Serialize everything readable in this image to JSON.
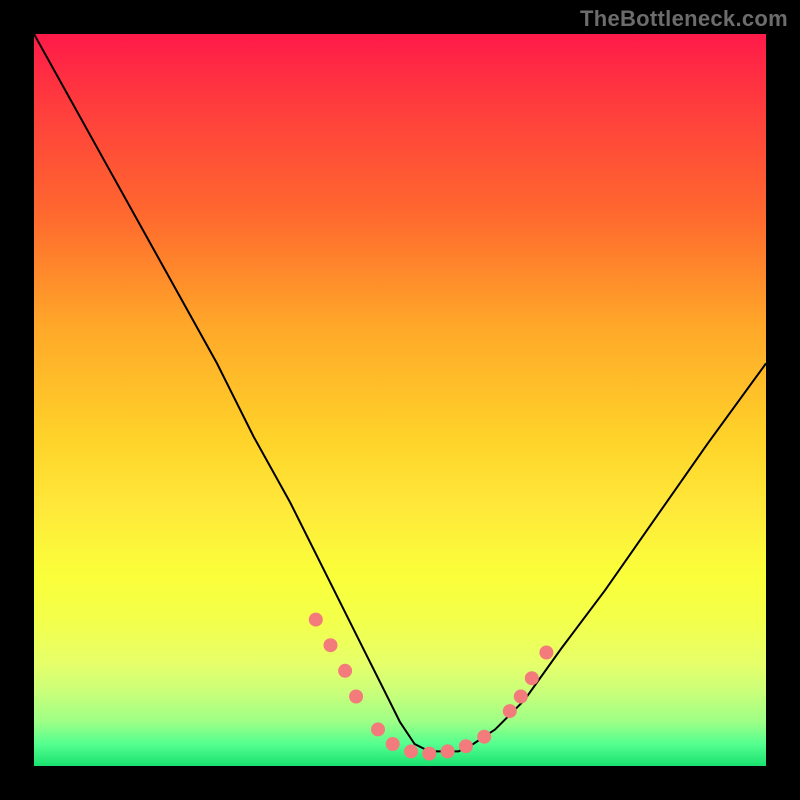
{
  "watermark": "TheBottleneck.com",
  "chart_data": {
    "type": "line",
    "title": "",
    "xlabel": "",
    "ylabel": "",
    "xlim": [
      0,
      100
    ],
    "ylim": [
      0,
      100
    ],
    "grid": false,
    "series": [
      {
        "name": "bottleneck-curve",
        "note": "V-shaped curve; y is qualitative (red=bad, green=good). Values are percent of plot height from top.",
        "x": [
          0,
          5,
          10,
          15,
          20,
          25,
          30,
          35,
          40,
          45,
          48,
          50,
          52,
          54,
          56,
          58,
          60,
          63,
          67,
          72,
          78,
          85,
          92,
          100
        ],
        "y": [
          0,
          9,
          18,
          27,
          36,
          45,
          55,
          64,
          74,
          84,
          90,
          94,
          97,
          98,
          98,
          98,
          97,
          95,
          91,
          84,
          76,
          66,
          56,
          45
        ]
      }
    ],
    "markers": {
      "name": "highlight-dots",
      "color": "#f47b7b",
      "x": [
        38.5,
        40.5,
        42.5,
        44.0,
        47.0,
        49.0,
        51.5,
        54.0,
        56.5,
        59.0,
        61.5,
        65.0,
        66.5,
        68.0,
        70.0
      ],
      "y": [
        80.0,
        83.5,
        87.0,
        90.5,
        95.0,
        97.0,
        98.0,
        98.3,
        98.0,
        97.3,
        96.0,
        92.5,
        90.5,
        88.0,
        84.5
      ]
    }
  }
}
